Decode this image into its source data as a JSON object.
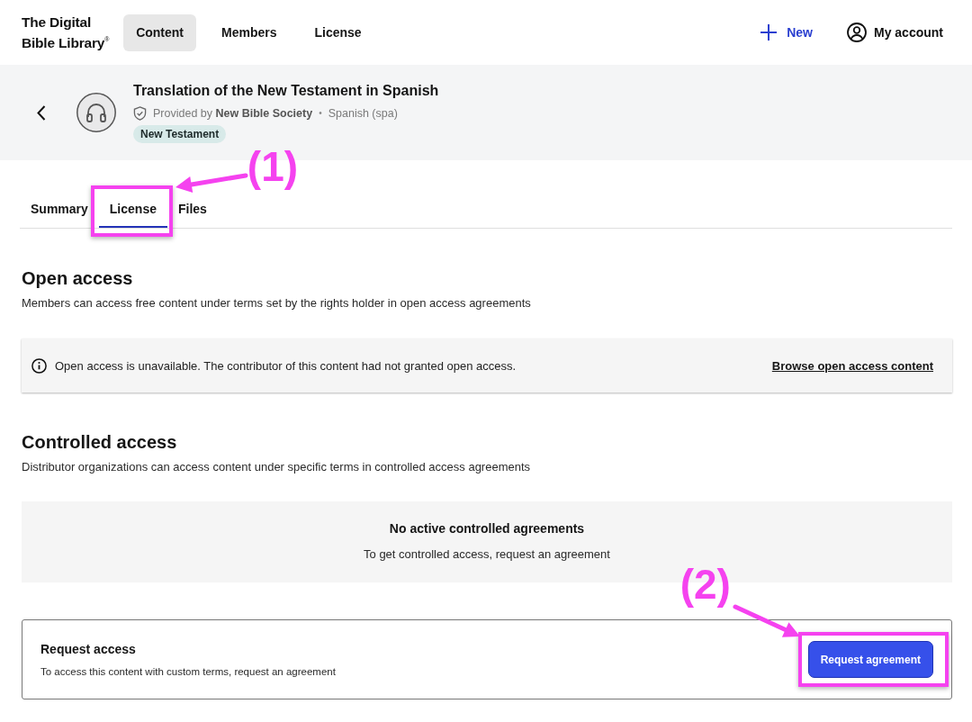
{
  "nav": {
    "logo": [
      "The Digital",
      "Bible Library$^{®}$"
    ],
    "items": [
      {
        "label": "Content",
        "selected": true
      },
      {
        "label": "Members",
        "selected": false
      },
      {
        "label": "License",
        "selected": false
      }
    ],
    "new_button": "New",
    "account_button": "My account"
  },
  "header": {
    "title": "Translation of the New Testament in Spanish",
    "provider": "Provided by **New Bible Society**",
    "separator": "•",
    "language": "Spanish (spa)",
    "tag": "New Testament"
  },
  "tabs": [
    {
      "label": "Summary",
      "selected": false
    },
    {
      "label": "License",
      "selected": true,
      "callout": "(1)"
    },
    {
      "label": "Files",
      "selected": false
    }
  ],
  "open_access": {
    "heading": "Open access",
    "description": "Members can access free content under terms set by the rights holder in open access agreements",
    "notice": {
      "text": "Open access is unavailable. The contributor of this content had not granted open access.",
      "link": "Browse open access content"
    }
  },
  "controlled_access": {
    "heading": "Controlled access",
    "description": "Distributor organizations can access content under specific terms in controlled access agreements",
    "empty_state": {
      "title": "No active controlled agreements",
      "text": "To get controlled access, request an agreement"
    }
  },
  "request_access": {
    "title": "Request access",
    "text": "To access this content with custom terms, request an agreement",
    "button": "Request agreement",
    "button_callout": "(2)"
  }
}
